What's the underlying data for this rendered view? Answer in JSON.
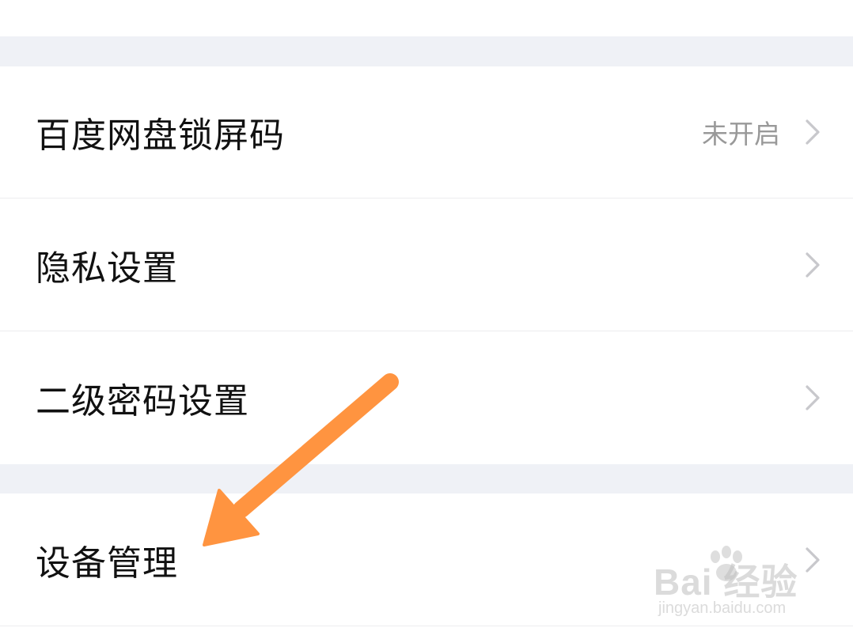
{
  "settings": {
    "items": [
      {
        "label": "百度网盘锁屏码",
        "value": "未开启"
      },
      {
        "label": "隐私设置",
        "value": ""
      },
      {
        "label": "二级密码设置",
        "value": ""
      },
      {
        "label": "设备管理",
        "value": ""
      }
    ]
  },
  "icons": {
    "chevron": "chevron-right-icon",
    "arrow": "annotation-arrow"
  },
  "colors": {
    "background": "#ffffff",
    "section_gap": "#eff1f6",
    "label": "#111111",
    "secondary_text": "#999999",
    "chevron": "#c8c8cc",
    "arrow": "#ff9440"
  },
  "watermark": {
    "logo": "Bai 经验",
    "url": "jingyan.baidu.com"
  }
}
